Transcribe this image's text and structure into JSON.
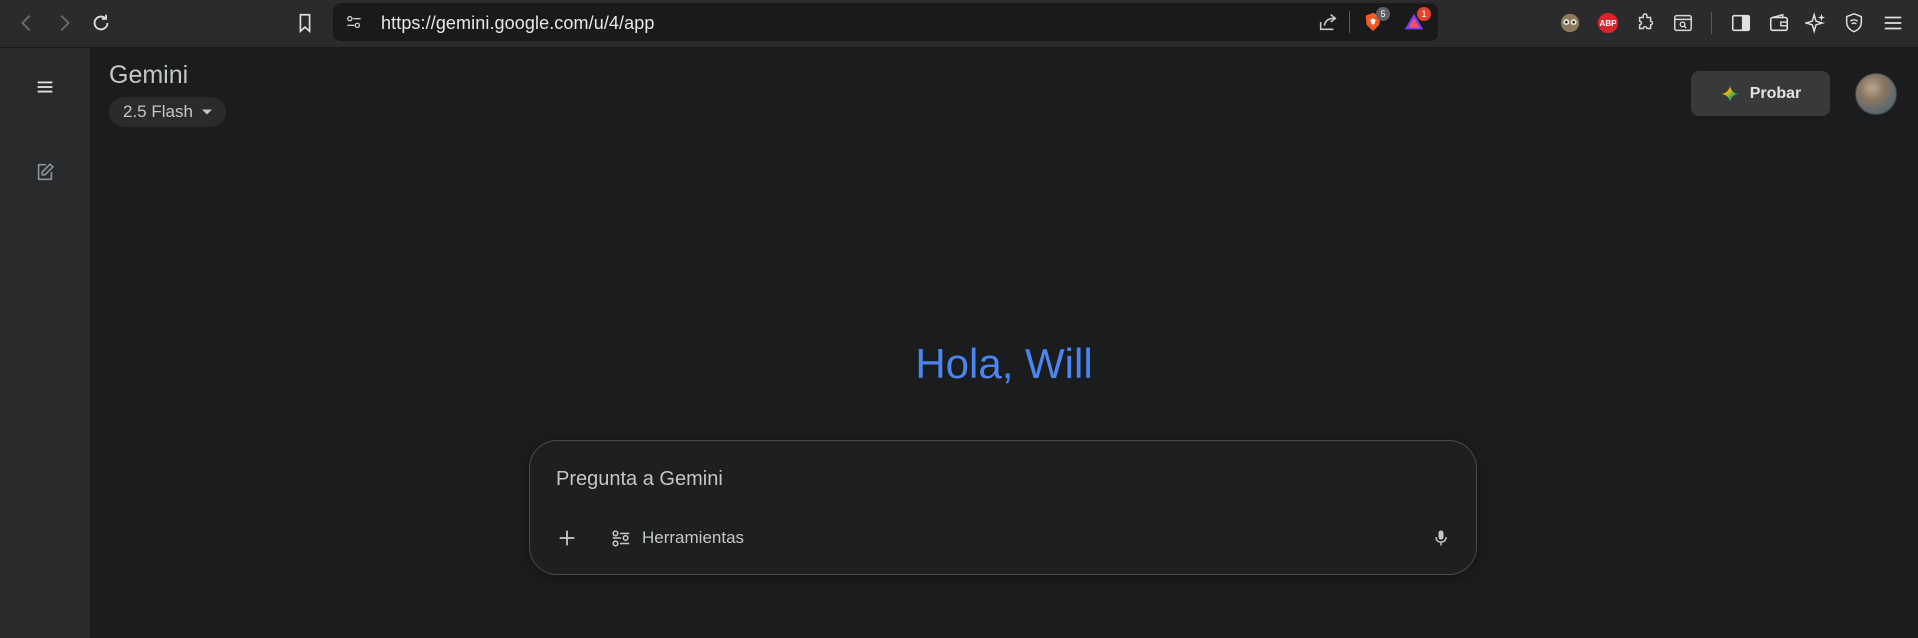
{
  "browser": {
    "url": "https://gemini.google.com/u/4/app",
    "brave_shields_count": "5",
    "rewards_count": "1",
    "adblock_label": "ABP"
  },
  "app": {
    "title": "Gemini",
    "model": "2.5 Flash",
    "try_label": "Probar"
  },
  "main": {
    "greeting": "Hola, Will",
    "prompt_placeholder": "Pregunta a Gemini",
    "tools_label": "Herramientas"
  },
  "colors": {
    "greeting": "#4a85f0",
    "background": "#1b1c1d",
    "rail": "#282a2c"
  },
  "icons": [
    "back-icon",
    "forward-icon",
    "reload-icon",
    "bookmark-icon",
    "site-settings-icon",
    "share-icon",
    "brave-shields-icon",
    "brave-rewards-icon",
    "extension-icon",
    "puzzle-icon",
    "sidebar-icon",
    "wallet-icon",
    "leo-ai-icon",
    "vpn-icon",
    "menu-icon",
    "hamburger-icon",
    "new-chat-icon",
    "sparkle-icon",
    "plus-icon",
    "tools-icon",
    "mic-icon"
  ]
}
